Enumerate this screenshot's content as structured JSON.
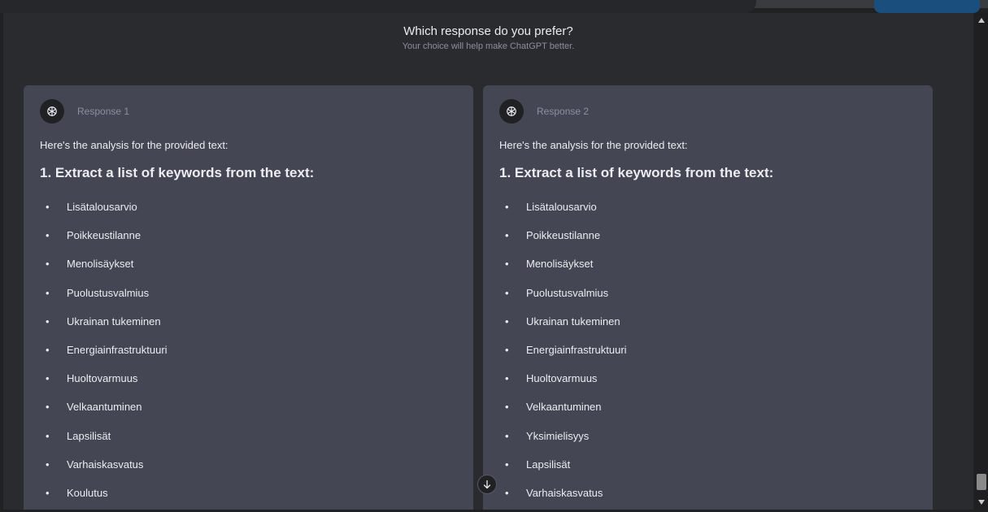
{
  "header": {
    "title": "Which response do you prefer?",
    "subtitle": "Your choice will help make ChatGPT better."
  },
  "responses": [
    {
      "label": "Response 1",
      "intro": "Here's the analysis for the provided text:",
      "heading": "1. Extract a list of keywords from the text:",
      "keywords": [
        "Lisätalousarvio",
        "Poikkeustilanne",
        "Menolisäykset",
        "Puolustusvalmius",
        "Ukrainan tukeminen",
        "Energiainfrastruktuuri",
        "Huoltovarmuus",
        "Velkaantuminen",
        "Lapsilisät",
        "Varhaiskasvatus",
        "Koulutus"
      ]
    },
    {
      "label": "Response 2",
      "intro": "Here's the analysis for the provided text:",
      "heading": "1. Extract a list of keywords from the text:",
      "keywords": [
        "Lisätalousarvio",
        "Poikkeustilanne",
        "Menolisäykset",
        "Puolustusvalmius",
        "Ukrainan tukeminen",
        "Energiainfrastruktuuri",
        "Huoltovarmuus",
        "Velkaantuminen",
        "Yksimielisyys",
        "Lapsilisät",
        "Varhaiskasvatus"
      ]
    }
  ],
  "icons": {
    "avatar": "openai-logo-icon",
    "scroll": "arrow-down-icon"
  },
  "colors": {
    "background": "#202123",
    "card": "#444654",
    "text": "#ececf1",
    "muted": "#8e8ea0"
  }
}
